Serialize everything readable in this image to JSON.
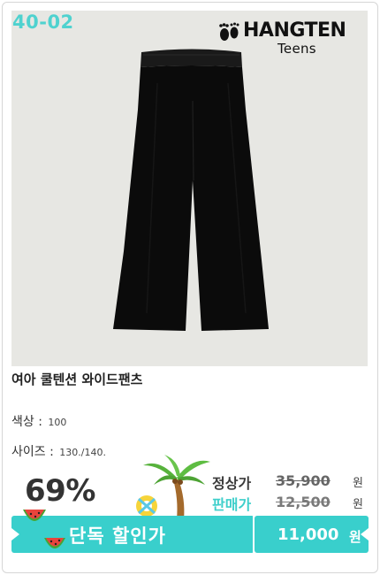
{
  "product": {
    "code": "40-02",
    "name": "여아 쿨텐션 와이드팬츠",
    "image": "black-wide-pants"
  },
  "brand": {
    "name": "HANGTEN",
    "sub": "Teens",
    "logo_icon": "footprints-icon"
  },
  "options": {
    "color_label": "색상 :",
    "color_value": "100",
    "size_label": "사이즈 :",
    "size_value": "130./140."
  },
  "pricing": {
    "discount": "69%",
    "regular_label": "정상가",
    "regular_price": "35,900",
    "sale_label": "판매가",
    "sale_price": "12,500",
    "currency": "원",
    "exclusive_label": "단독 할인가",
    "final_price": "11,000",
    "final_currency": "원"
  },
  "colors": {
    "accent": "#39cfcc",
    "code_color": "#4fd2cf",
    "photo_bg": "#e7e7e3"
  }
}
